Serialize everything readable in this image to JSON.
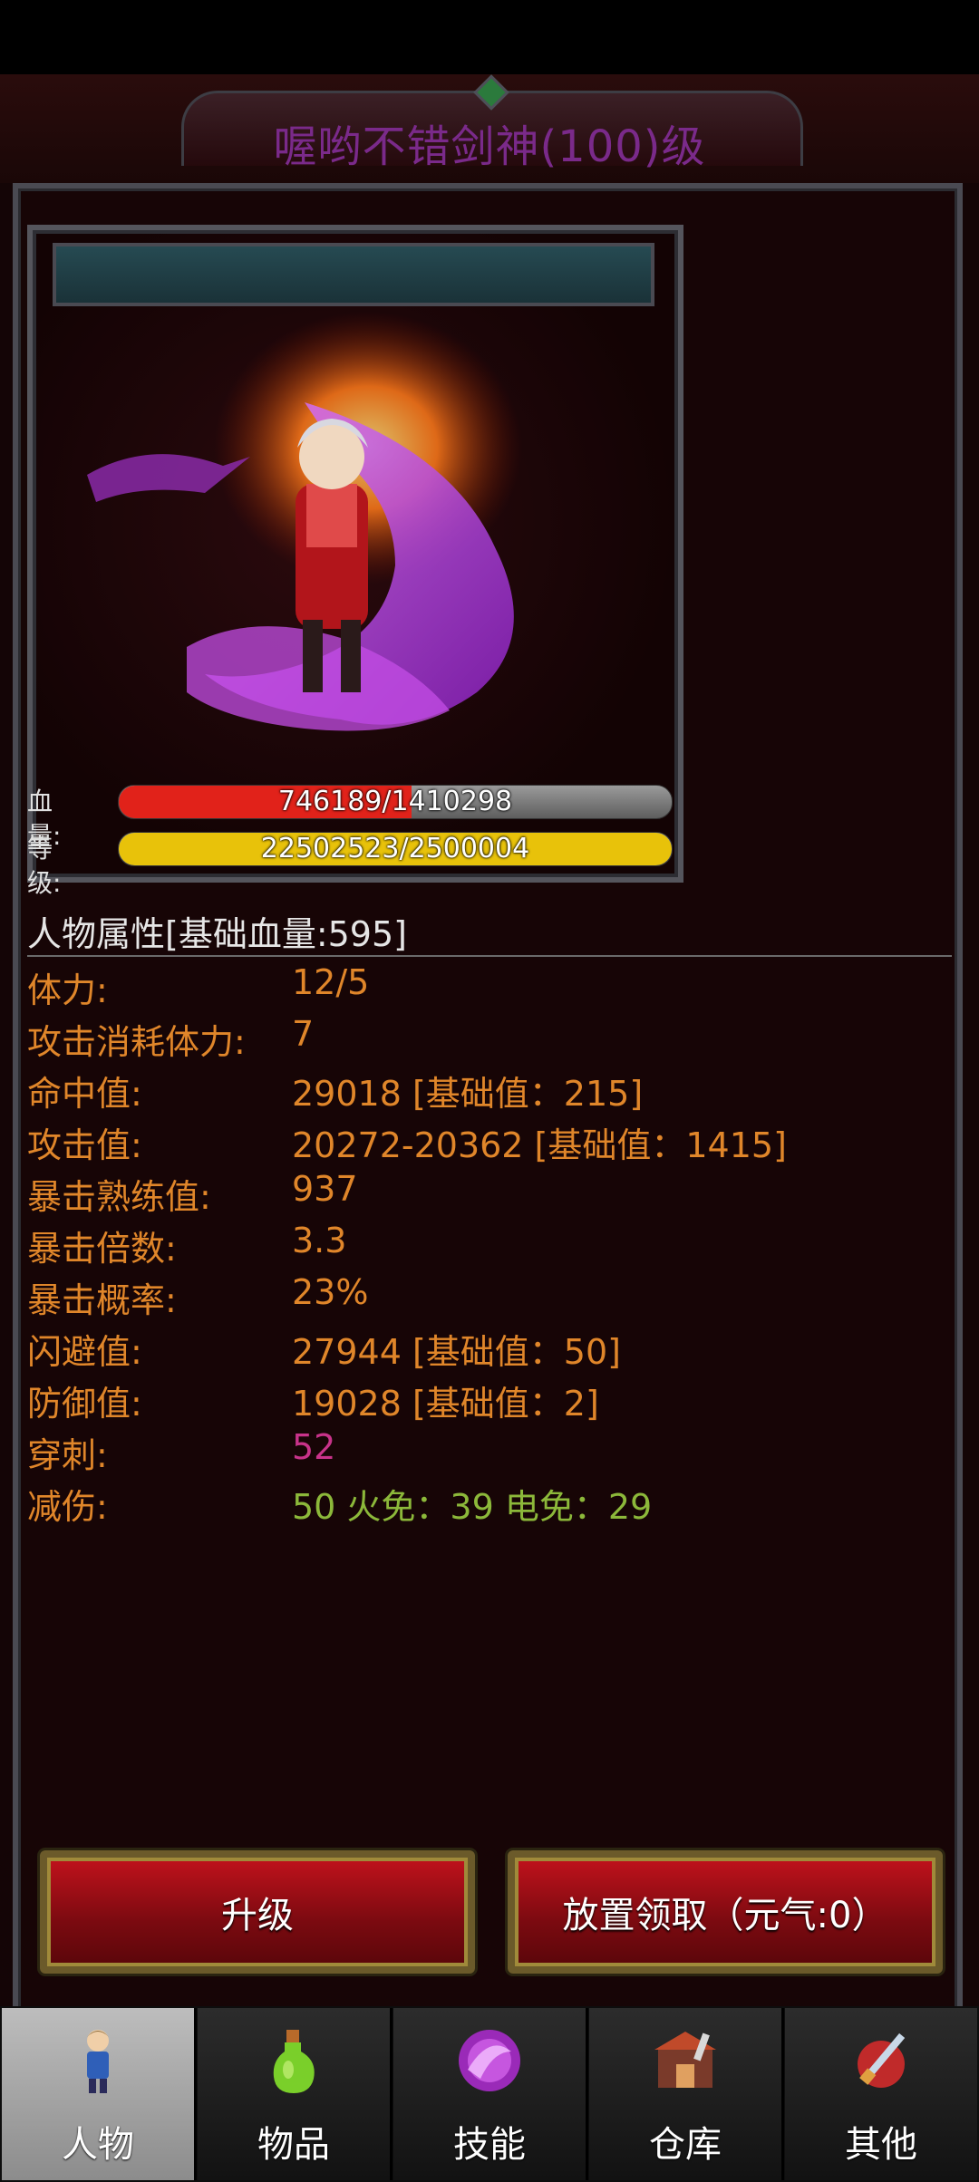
{
  "title": "喔哟不错剑神(100)级",
  "hp": {
    "label": "血量:",
    "text": "746189/1410298",
    "fraction": 0.529,
    "color": "#e1221a"
  },
  "level": {
    "label": "等级:",
    "text": "22502523/2500004",
    "fraction": 1.0,
    "color": "#e8c20a"
  },
  "attributes": {
    "section_title": "人物属性[基础血量:595]",
    "rows": [
      {
        "label": "体力:",
        "value": "12/5"
      },
      {
        "label": "攻击消耗体力:",
        "value": "7"
      },
      {
        "label": "命中值:",
        "value": "29018 [基础值：215]"
      },
      {
        "label": "攻击值:",
        "value": "20272-20362 [基础值：1415]"
      },
      {
        "label": "暴击熟练值:",
        "value": "937"
      },
      {
        "label": "暴击倍数:",
        "value": "3.3"
      },
      {
        "label": "暴击概率:",
        "value": "23%"
      },
      {
        "label": "闪避值:",
        "value": "27944 [基础值：50]"
      },
      {
        "label": "防御值:",
        "value": "19028 [基础值：2]"
      },
      {
        "label": "穿刺:",
        "value": "52"
      },
      {
        "label": "减伤:",
        "value": "50 火免：39 电免：29"
      }
    ]
  },
  "buttons": {
    "upgrade": "升级",
    "idle_reward": "放置领取（元气:0）"
  },
  "tabs": [
    {
      "label": "人物",
      "icon": "character-icon",
      "active": true
    },
    {
      "label": "物品",
      "icon": "potion-icon",
      "active": false
    },
    {
      "label": "技能",
      "icon": "skill-orb-icon",
      "active": false
    },
    {
      "label": "仓库",
      "icon": "warehouse-icon",
      "active": false
    },
    {
      "label": "其他",
      "icon": "other-icon",
      "active": false
    }
  ],
  "colors": {
    "stat_text": "#e0862a",
    "pierce_value": "#c8338a",
    "damage_reduction_value": "#8cb83a",
    "title": "#7a2a8a"
  }
}
